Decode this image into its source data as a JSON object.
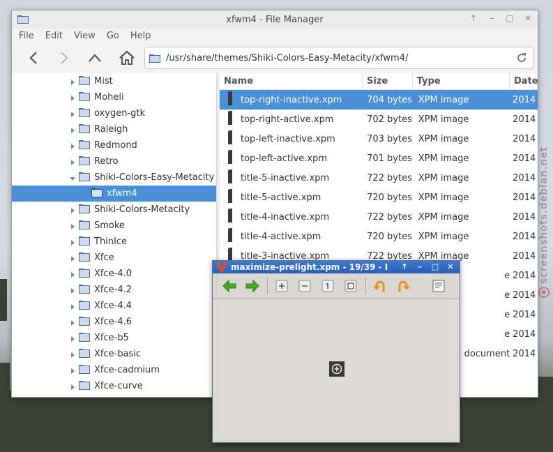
{
  "file_manager": {
    "title": "xfwm4 - File Manager",
    "menu": [
      "File",
      "Edit",
      "View",
      "Go",
      "Help"
    ],
    "path": "/usr/share/themes/Shiki-Colors-Easy-Metacity/xfwm4/",
    "tree": [
      {
        "label": "Mist",
        "depth": 0,
        "expanded": false,
        "selected": false
      },
      {
        "label": "Moheli",
        "depth": 0,
        "expanded": false,
        "selected": false
      },
      {
        "label": "oxygen-gtk",
        "depth": 0,
        "expanded": false,
        "selected": false
      },
      {
        "label": "Raleigh",
        "depth": 0,
        "expanded": false,
        "selected": false
      },
      {
        "label": "Redmond",
        "depth": 0,
        "expanded": false,
        "selected": false
      },
      {
        "label": "Retro",
        "depth": 0,
        "expanded": false,
        "selected": false
      },
      {
        "label": "Shiki-Colors-Easy-Metacity",
        "depth": 0,
        "expanded": true,
        "selected": false
      },
      {
        "label": "xfwm4",
        "depth": 1,
        "expanded": false,
        "selected": true
      },
      {
        "label": "Shiki-Colors-Metacity",
        "depth": 0,
        "expanded": false,
        "selected": false
      },
      {
        "label": "Smoke",
        "depth": 0,
        "expanded": false,
        "selected": false
      },
      {
        "label": "ThinIce",
        "depth": 0,
        "expanded": false,
        "selected": false
      },
      {
        "label": "Xfce",
        "depth": 0,
        "expanded": false,
        "selected": false
      },
      {
        "label": "Xfce-4.0",
        "depth": 0,
        "expanded": false,
        "selected": false
      },
      {
        "label": "Xfce-4.2",
        "depth": 0,
        "expanded": false,
        "selected": false
      },
      {
        "label": "Xfce-4.4",
        "depth": 0,
        "expanded": false,
        "selected": false
      },
      {
        "label": "Xfce-4.6",
        "depth": 0,
        "expanded": false,
        "selected": false
      },
      {
        "label": "Xfce-b5",
        "depth": 0,
        "expanded": false,
        "selected": false
      },
      {
        "label": "Xfce-basic",
        "depth": 0,
        "expanded": false,
        "selected": false
      },
      {
        "label": "Xfce-cadmium",
        "depth": 0,
        "expanded": false,
        "selected": false
      },
      {
        "label": "Xfce-curve",
        "depth": 0,
        "expanded": false,
        "selected": false
      }
    ],
    "columns": {
      "name": "Name",
      "size": "Size",
      "type": "Type",
      "date": "Date"
    },
    "files": [
      {
        "name": "top-right-inactive.xpm",
        "size": "704 bytes",
        "type": "XPM image",
        "date": "2014",
        "selected": true
      },
      {
        "name": "top-right-active.xpm",
        "size": "702 bytes",
        "type": "XPM image",
        "date": "2014",
        "selected": false
      },
      {
        "name": "top-left-inactive.xpm",
        "size": "703 bytes",
        "type": "XPM image",
        "date": "2014",
        "selected": false
      },
      {
        "name": "top-left-active.xpm",
        "size": "701 bytes",
        "type": "XPM image",
        "date": "2014",
        "selected": false
      },
      {
        "name": "title-5-inactive.xpm",
        "size": "722 bytes",
        "type": "XPM image",
        "date": "2014",
        "selected": false
      },
      {
        "name": "title-5-active.xpm",
        "size": "720 bytes",
        "type": "XPM image",
        "date": "2014",
        "selected": false
      },
      {
        "name": "title-4-inactive.xpm",
        "size": "722 bytes",
        "type": "XPM image",
        "date": "2014",
        "selected": false
      },
      {
        "name": "title-4-active.xpm",
        "size": "720 bytes",
        "type": "XPM image",
        "date": "2014",
        "selected": false
      },
      {
        "name": "title-3-inactive.xpm",
        "size": "722 bytes",
        "type": "XPM image",
        "date": "2014",
        "selected": false
      },
      {
        "name": "",
        "size": "",
        "type": "e",
        "date": "2014",
        "selected": false
      },
      {
        "name": "",
        "size": "",
        "type": "e",
        "date": "2014",
        "selected": false
      },
      {
        "name": "",
        "size": "",
        "type": "e",
        "date": "2014",
        "selected": false
      },
      {
        "name": "",
        "size": "",
        "type": "e",
        "date": "2014",
        "selected": false
      },
      {
        "name": "",
        "size": "",
        "type": "document",
        "date": "2014",
        "selected": false
      }
    ]
  },
  "viewer": {
    "title": "maximize-prelight.xpm - 19/39 - I"
  },
  "watermark": {
    "text": "screenshots.debian.net"
  },
  "colors": {
    "selection": "#4a90d9",
    "viewer_titlebar": "#2a5fb7"
  }
}
